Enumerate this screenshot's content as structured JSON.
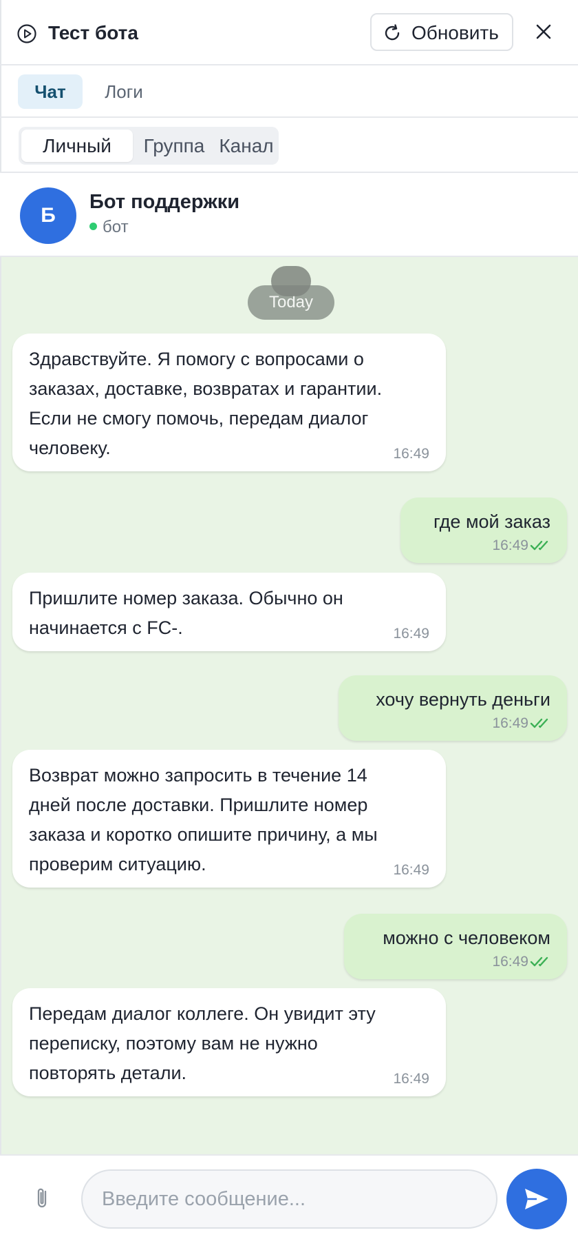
{
  "header": {
    "title": "Тест бота",
    "refresh_label": "Обновить"
  },
  "tabs": [
    {
      "label": "Чат",
      "active": true
    },
    {
      "label": "Логи",
      "active": false
    }
  ],
  "segments": [
    {
      "label": "Личный",
      "active": true
    },
    {
      "label": "Группа",
      "active": false
    },
    {
      "label": "Канал",
      "active": false
    }
  ],
  "contact": {
    "avatar_letter": "Б",
    "name": "Бот поддержки",
    "status": "бот"
  },
  "chat": {
    "date_label": "Today",
    "messages": [
      {
        "direction": "in",
        "lines": [
          "Здравствуйте. Я помогу с вопросами о",
          "заказах, доставке, возвратах и гарантии.",
          "Если не смогу помочь, передам диалог",
          "человеку."
        ],
        "time": "16:49"
      },
      {
        "direction": "out",
        "lines": [
          "где мой заказ"
        ],
        "time": "16:49",
        "read": true
      },
      {
        "direction": "in",
        "lines": [
          "Пришлите номер заказа. Обычно он",
          "начинается с FC-."
        ],
        "time": "16:49"
      },
      {
        "direction": "out",
        "lines": [
          "хочу вернуть деньги"
        ],
        "time": "16:49",
        "read": true
      },
      {
        "direction": "in",
        "lines": [
          "Возврат можно запросить в течение 14",
          "дней после доставки. Пришлите номер",
          "заказа и коротко опишите причину, а мы",
          "проверим ситуацию."
        ],
        "time": "16:49"
      },
      {
        "direction": "out",
        "lines": [
          "можно с человеком"
        ],
        "time": "16:49",
        "read": true
      },
      {
        "direction": "in",
        "lines": [
          "Передам диалог коллеге. Он увидит эту",
          "переписку, поэтому вам не нужно",
          "повторять детали."
        ],
        "time": "16:49"
      }
    ]
  },
  "composer": {
    "placeholder": "Введите сообщение...",
    "value": ""
  },
  "colors": {
    "accent": "#2f6fe0",
    "chat_bg": "#e9f4e5",
    "outgoing_bubble": "#d9f2cf",
    "read_ticks": "#3cb055",
    "online_dot": "#2ecc71"
  },
  "icons": {
    "header": "play-circle-icon",
    "refresh": "refresh-icon",
    "close": "close-icon",
    "attach": "paperclip-icon",
    "send": "send-icon",
    "read": "double-check-icon"
  }
}
